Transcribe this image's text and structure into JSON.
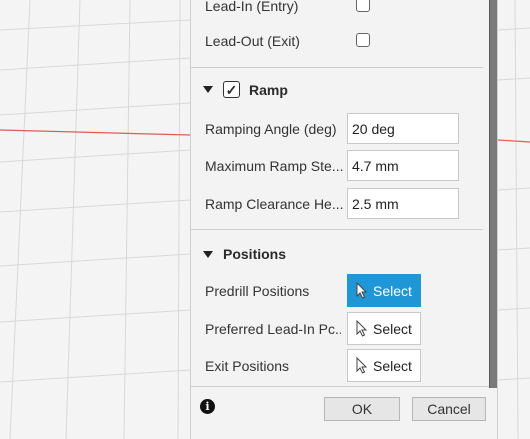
{
  "lead_in_label": "Lead-In (Entry)",
  "lead_out_label": "Lead-Out (Exit)",
  "ramp": {
    "title": "Ramp",
    "checked": true,
    "fields": [
      {
        "label": "Ramping Angle (deg)",
        "value": "20 deg"
      },
      {
        "label": "Maximum Ramp Ste...",
        "value": "4.7 mm"
      },
      {
        "label": "Ramp Clearance He...",
        "value": "2.5 mm"
      }
    ]
  },
  "positions": {
    "title": "Positions",
    "rows": [
      {
        "label": "Predrill Positions",
        "button": "Select",
        "active": true
      },
      {
        "label": "Preferred Lead-In Pc...",
        "button": "Select",
        "active": false
      },
      {
        "label": "Exit Positions",
        "button": "Select",
        "active": false
      }
    ]
  },
  "footer": {
    "ok_label": "OK",
    "cancel_label": "Cancel",
    "info_glyph": "i"
  },
  "colors": {
    "accent": "#1f96d6",
    "grid_red": "#e35a5a"
  }
}
